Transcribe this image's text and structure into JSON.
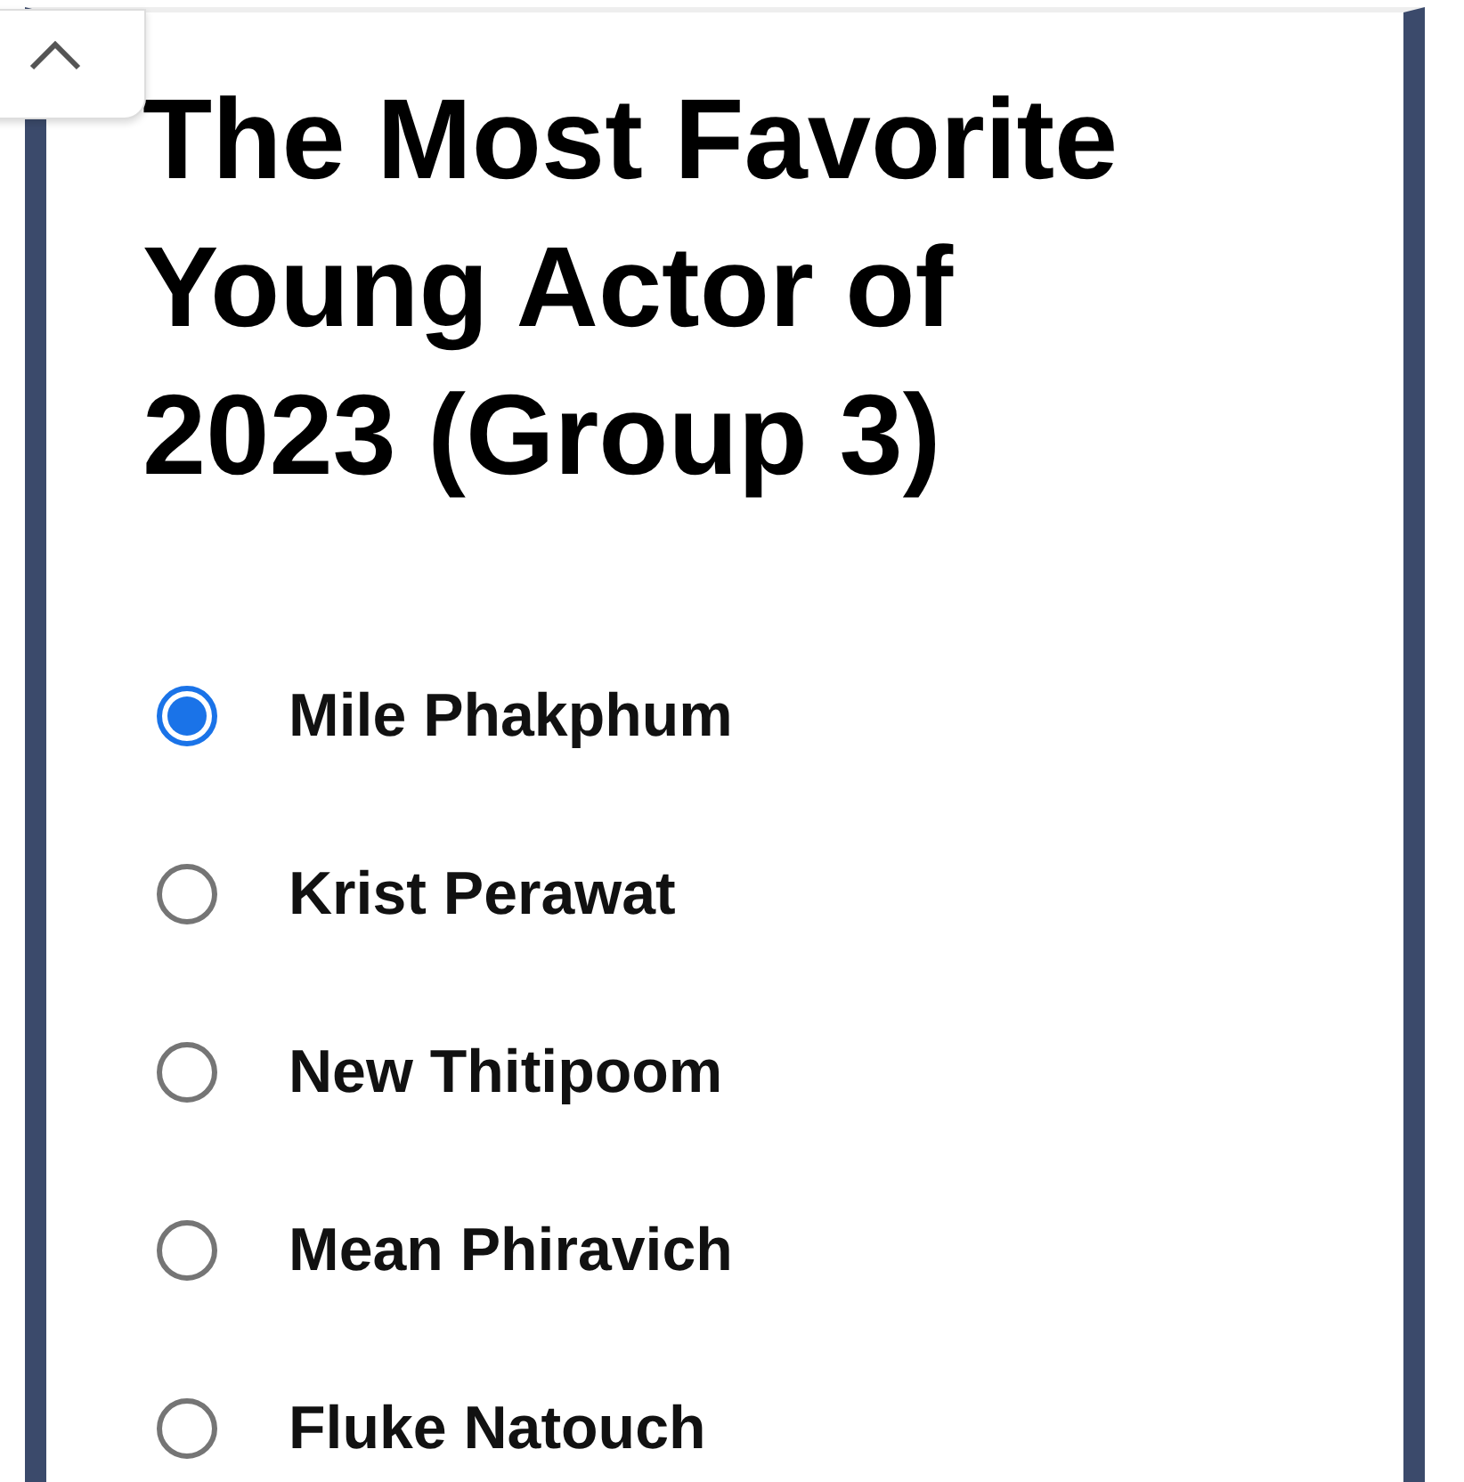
{
  "title": "The Most Favorite Young Actor of 2023 (Group 3)",
  "options": [
    {
      "label": "Mile Phakphum",
      "selected": true
    },
    {
      "label": "Krist Perawat",
      "selected": false
    },
    {
      "label": "New Thitipoom",
      "selected": false
    },
    {
      "label": "Mean Phiravich",
      "selected": false
    },
    {
      "label": "Fluke Natouch",
      "selected": false
    }
  ]
}
